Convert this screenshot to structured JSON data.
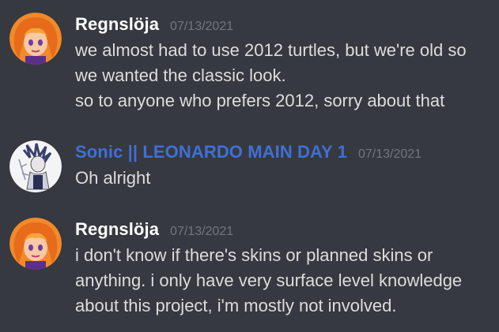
{
  "colors": {
    "background": "#36393f",
    "username_default": "#ffffff",
    "username_sonic": "#3f6fd9",
    "timestamp": "#72767d",
    "message_text": "#dcddde"
  },
  "messages": [
    {
      "avatar": "adagio-avatar-icon",
      "username": "Regnslöja",
      "timestamp": "07/13/2021",
      "lines": [
        "we almost had to use 2012 turtles, but we're old so",
        "we wanted the classic look.",
        "so to anyone who prefers 2012, sorry about that"
      ]
    },
    {
      "avatar": "sketch-character-avatar-icon",
      "username": "Sonic || LEONARDO MAIN DAY 1",
      "timestamp": "07/13/2021",
      "lines": [
        "Oh alright"
      ]
    },
    {
      "avatar": "adagio-avatar-icon",
      "username": "Regnslöja",
      "timestamp": "07/13/2021",
      "lines": [
        "i don't know if there's skins or planned skins or",
        "anything. i only have very surface level knowledge",
        "about this project, i'm mostly not involved."
      ]
    }
  ]
}
